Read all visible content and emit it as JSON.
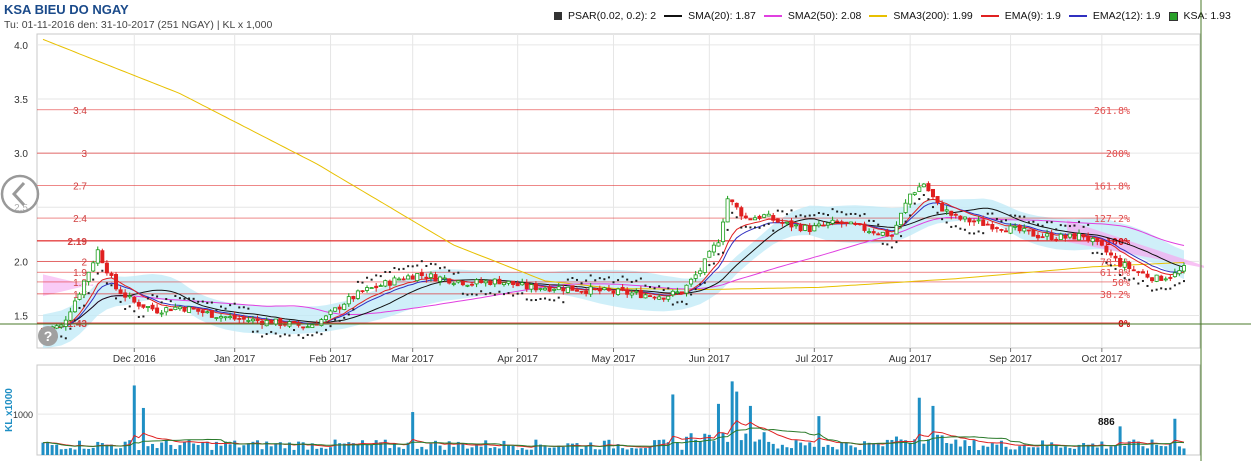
{
  "title": "KSA BIEU DO NGAY",
  "subtitle": "Tu: 01-11-2016 den: 31-10-2017 (251 NGAY) | KL x 1,000",
  "legend": [
    {
      "label": "PSAR(0.02, 0.2): 2",
      "color": "#333333",
      "kind": "square"
    },
    {
      "label": "SMA(20): 1.87",
      "color": "#111111",
      "kind": "line"
    },
    {
      "label": "SMA2(50): 2.08",
      "color": "#e040e0",
      "kind": "line"
    },
    {
      "label": "SMA3(200): 1.99",
      "color": "#e8c000",
      "kind": "line"
    },
    {
      "label": "EMA(9): 1.9",
      "color": "#e02020",
      "kind": "line"
    },
    {
      "label": "EMA2(12): 1.9",
      "color": "#3030c0",
      "kind": "line"
    },
    {
      "label": "KSA: 1.93",
      "color": "#1a9e1a",
      "kind": "square2"
    }
  ],
  "colors": {
    "candle_up": "#1a9e1a",
    "candle_down": "#e02020",
    "volume_bar": "#1f8fc4",
    "cloud_cyan": "#bfeaf7",
    "cloud_pink": "#f5a8f0",
    "fib_line": "#e02020",
    "grid": "#e6e6e6"
  },
  "chart_data": [
    {
      "type": "candlestick",
      "ylim": [
        1.2,
        4.1
      ],
      "yticks": [
        "1.0",
        "1.5",
        "2.0",
        "2.5",
        "3.0",
        "3.5",
        "4.0"
      ],
      "yticks_values": [
        1.0,
        1.5,
        2.0,
        2.5,
        3.0,
        3.5,
        4.0
      ],
      "x_labels": [
        "Dec 2016",
        "Jan 2017",
        "Feb 2017",
        "Mar 2017",
        "Apr 2017",
        "May 2017",
        "Jun 2017",
        "Jul 2017",
        "Aug 2017",
        "Sep 2017",
        "Oct 2017"
      ],
      "x_label_index": [
        20,
        42,
        63,
        81,
        104,
        125,
        146,
        169,
        190,
        212,
        232
      ],
      "n_days": 251,
      "close_anchors": [
        [
          0,
          1.38
        ],
        [
          4,
          1.4
        ],
        [
          8,
          1.72
        ],
        [
          12,
          2.1
        ],
        [
          16,
          1.75
        ],
        [
          20,
          1.62
        ],
        [
          25,
          1.55
        ],
        [
          30,
          1.58
        ],
        [
          36,
          1.52
        ],
        [
          42,
          1.47
        ],
        [
          50,
          1.44
        ],
        [
          58,
          1.4
        ],
        [
          62,
          1.48
        ],
        [
          66,
          1.62
        ],
        [
          70,
          1.72
        ],
        [
          74,
          1.78
        ],
        [
          78,
          1.84
        ],
        [
          82,
          1.88
        ],
        [
          88,
          1.84
        ],
        [
          94,
          1.8
        ],
        [
          100,
          1.82
        ],
        [
          106,
          1.76
        ],
        [
          112,
          1.76
        ],
        [
          118,
          1.74
        ],
        [
          124,
          1.72
        ],
        [
          130,
          1.7
        ],
        [
          136,
          1.68
        ],
        [
          140,
          1.72
        ],
        [
          144,
          1.92
        ],
        [
          148,
          2.2
        ],
        [
          150,
          2.58
        ],
        [
          154,
          2.4
        ],
        [
          158,
          2.42
        ],
        [
          162,
          2.35
        ],
        [
          168,
          2.3
        ],
        [
          174,
          2.36
        ],
        [
          180,
          2.3
        ],
        [
          186,
          2.24
        ],
        [
          190,
          2.62
        ],
        [
          193,
          2.72
        ],
        [
          196,
          2.52
        ],
        [
          200,
          2.4
        ],
        [
          206,
          2.35
        ],
        [
          212,
          2.3
        ],
        [
          218,
          2.24
        ],
        [
          224,
          2.22
        ],
        [
          228,
          2.24
        ],
        [
          232,
          2.12
        ],
        [
          236,
          1.98
        ],
        [
          240,
          1.9
        ],
        [
          244,
          1.84
        ],
        [
          248,
          1.88
        ],
        [
          250,
          1.93
        ]
      ],
      "fibonacci": [
        {
          "label": "0%",
          "value": 1.43
        },
        {
          "label": "38.2%",
          "value": 1.7
        },
        {
          "label": "50%",
          "value": 1.81
        },
        {
          "label": "61.8%",
          "value": 1.9
        },
        {
          "label": "78.6%",
          "value": 2.0
        },
        {
          "label": "100%",
          "value": 2.19
        },
        {
          "label": "127.2%",
          "value": 2.4
        },
        {
          "label": "161.8%",
          "value": 2.7
        },
        {
          "label": "200%",
          "value": 3.0
        },
        {
          "label": "261.8%",
          "value": 3.4
        }
      ],
      "left_levels": [
        {
          "label": "1.43",
          "value": 1.43
        },
        {
          "label": "1.7",
          "value": 1.7
        },
        {
          "label": "1.8",
          "value": 1.81
        },
        {
          "label": "1.9",
          "value": 1.9
        },
        {
          "label": "2",
          "value": 2.0
        },
        {
          "label": "2.19",
          "value": 2.19
        },
        {
          "label": "2.4",
          "value": 2.4
        },
        {
          "label": "2.7",
          "value": 2.7
        },
        {
          "label": "3",
          "value": 3.0
        },
        {
          "label": "3.4",
          "value": 3.4
        }
      ],
      "sma200_anchors": [
        [
          0,
          4.05
        ],
        [
          30,
          3.55
        ],
        [
          60,
          2.9
        ],
        [
          90,
          2.15
        ],
        [
          110,
          1.82
        ],
        [
          125,
          1.75
        ],
        [
          145,
          1.74
        ],
        [
          170,
          1.76
        ],
        [
          200,
          1.84
        ],
        [
          230,
          1.95
        ],
        [
          250,
          1.99
        ]
      ]
    },
    {
      "type": "bar",
      "ylabel": "KL x1000",
      "ylim": [
        0,
        2200
      ],
      "yticks": [
        "1000"
      ],
      "yticks_values": [
        1000
      ],
      "last_value_label": "886",
      "spikes": [
        [
          20,
          1700
        ],
        [
          22,
          1150
        ],
        [
          81,
          1050
        ],
        [
          138,
          1480
        ],
        [
          148,
          1250
        ],
        [
          151,
          1800
        ],
        [
          152,
          1550
        ],
        [
          155,
          1200
        ],
        [
          170,
          950
        ],
        [
          192,
          1400
        ],
        [
          195,
          1200
        ],
        [
          236,
          700
        ],
        [
          248,
          886
        ]
      ]
    }
  ]
}
